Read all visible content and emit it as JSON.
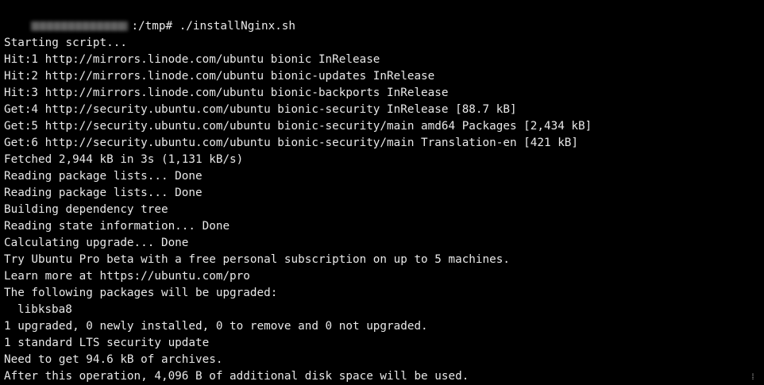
{
  "terminal": {
    "prompt": {
      "host_redacted": true,
      "path_and_command": ":/tmp# ./installNginx.sh"
    },
    "output_lines": [
      {
        "text": "Starting script..."
      },
      {
        "text": "Hit:1 http://mirrors.linode.com/ubuntu bionic InRelease"
      },
      {
        "text": "Hit:2 http://mirrors.linode.com/ubuntu bionic-updates InRelease"
      },
      {
        "text": "Hit:3 http://mirrors.linode.com/ubuntu bionic-backports InRelease"
      },
      {
        "text": "Get:4 http://security.ubuntu.com/ubuntu bionic-security InRelease [88.7 kB]"
      },
      {
        "text": "Get:5 http://security.ubuntu.com/ubuntu bionic-security/main amd64 Packages [2,434 kB]"
      },
      {
        "text": "Get:6 http://security.ubuntu.com/ubuntu bionic-security/main Translation-en [421 kB]"
      },
      {
        "text": "Fetched 2,944 kB in 3s (1,131 kB/s)"
      },
      {
        "text": "Reading package lists... Done"
      },
      {
        "text": "Reading package lists... Done"
      },
      {
        "text": "Building dependency tree"
      },
      {
        "text": "Reading state information... Done"
      },
      {
        "text": "Calculating upgrade... Done"
      },
      {
        "text": "Try Ubuntu Pro beta with a free personal subscription on up to 5 machines."
      },
      {
        "text": "Learn more at https://ubuntu.com/pro"
      },
      {
        "text": "The following packages will be upgraded:"
      },
      {
        "text": "libksba8",
        "indent": true
      },
      {
        "text": "1 upgraded, 0 newly installed, 0 to remove and 0 not upgraded."
      },
      {
        "text": "1 standard LTS security update"
      },
      {
        "text": "Need to get 94.6 kB of archives."
      },
      {
        "text": "After this operation, 4,096 B of additional disk space will be used."
      }
    ],
    "colors": {
      "background": "#000000",
      "foreground": "#e8e8e8"
    }
  }
}
